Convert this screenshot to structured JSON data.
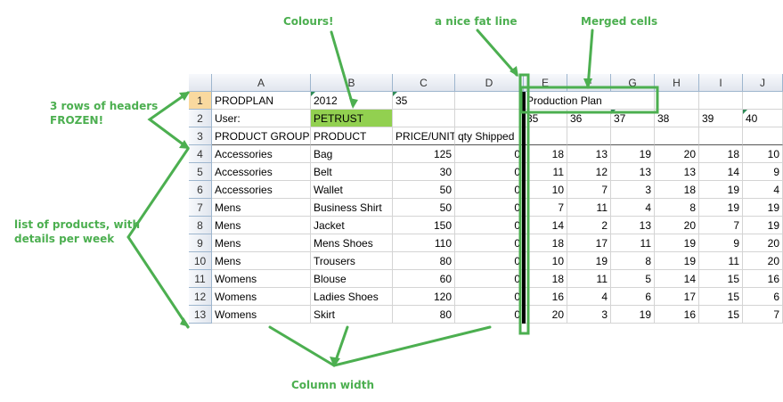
{
  "annotations": {
    "colours": "Colours!",
    "fat_line": "a nice fat line",
    "merged": "Merged cells",
    "frozen_line1": "3 rows of headers",
    "frozen_line2": "FROZEN!",
    "products_line1": "list of products, with",
    "products_line2": "details per week",
    "column_width": "Column width"
  },
  "columns": [
    "A",
    "B",
    "C",
    "D",
    "E",
    "F",
    "G",
    "H",
    "I",
    "J"
  ],
  "rows": [
    {
      "n": "1",
      "cells": [
        "PRODPLAN",
        "2012",
        "35",
        "",
        "Production Plan",
        "",
        "",
        "",
        "",
        ""
      ]
    },
    {
      "n": "2",
      "cells": [
        "User:",
        "PETRUST",
        "",
        "",
        "35",
        "36",
        "37",
        "38",
        "39",
        "40"
      ]
    },
    {
      "n": "3",
      "cells": [
        "PRODUCT GROUP",
        "PRODUCT",
        "PRICE/UNIT",
        "qty Shipped",
        "",
        "",
        "",
        "",
        "",
        ""
      ]
    },
    {
      "n": "4",
      "cells": [
        "Accessories",
        "Bag",
        "125",
        "0",
        "18",
        "13",
        "19",
        "20",
        "18",
        "10"
      ]
    },
    {
      "n": "5",
      "cells": [
        "Accessories",
        "Belt",
        "30",
        "0",
        "11",
        "12",
        "13",
        "13",
        "14",
        "9"
      ]
    },
    {
      "n": "6",
      "cells": [
        "Accessories",
        "Wallet",
        "50",
        "0",
        "10",
        "7",
        "3",
        "18",
        "19",
        "4"
      ]
    },
    {
      "n": "7",
      "cells": [
        "Mens",
        "Business Shirt",
        "50",
        "0",
        "7",
        "11",
        "4",
        "8",
        "19",
        "19"
      ]
    },
    {
      "n": "8",
      "cells": [
        "Mens",
        "Jacket",
        "150",
        "0",
        "14",
        "2",
        "13",
        "20",
        "7",
        "19"
      ]
    },
    {
      "n": "9",
      "cells": [
        "Mens",
        "Mens Shoes",
        "110",
        "0",
        "18",
        "17",
        "11",
        "19",
        "9",
        "20"
      ]
    },
    {
      "n": "10",
      "cells": [
        "Mens",
        "Trousers",
        "80",
        "0",
        "10",
        "19",
        "8",
        "19",
        "11",
        "20"
      ]
    },
    {
      "n": "11",
      "cells": [
        "Womens",
        "Blouse",
        "60",
        "0",
        "18",
        "11",
        "5",
        "14",
        "15",
        "16"
      ]
    },
    {
      "n": "12",
      "cells": [
        "Womens",
        "Ladies Shoes",
        "120",
        "0",
        "16",
        "4",
        "6",
        "17",
        "15",
        "6"
      ]
    },
    {
      "n": "13",
      "cells": [
        "Womens",
        "Skirt",
        "80",
        "0",
        "20",
        "3",
        "19",
        "16",
        "15",
        "7"
      ]
    }
  ],
  "colors": {
    "accent": "#4caf50",
    "selected_fill": "#92d050",
    "header_select": "#f9d99f"
  }
}
